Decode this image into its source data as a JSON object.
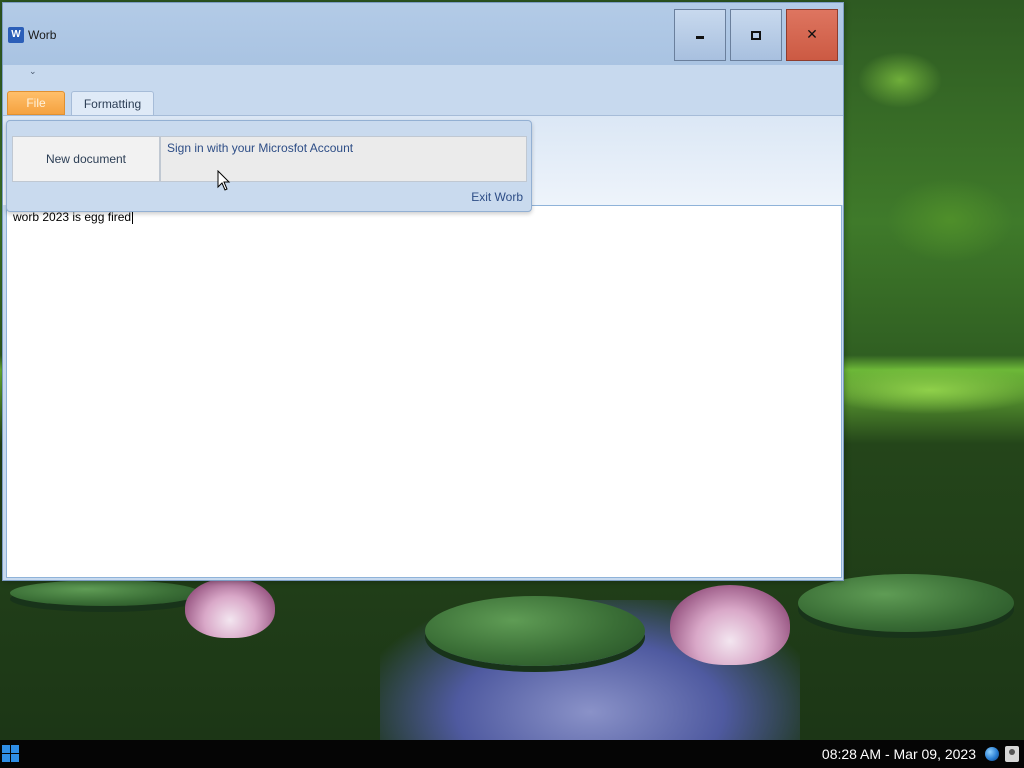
{
  "window": {
    "title": "Worb",
    "app_icon_letter": "W",
    "controls": {
      "minimize": "minimize-icon",
      "maximize": "maximize-icon",
      "close": "close-icon",
      "close_color": "#d0604a"
    }
  },
  "quick_access": {
    "glyph": "⌄"
  },
  "ribbon": {
    "tabs": [
      {
        "label": "File",
        "active": true,
        "color": "#f7a845"
      },
      {
        "label": "Formatting",
        "active": false
      }
    ]
  },
  "file_menu": {
    "new_document": "New document",
    "sign_in": "Sign in with your Microsfot Account",
    "exit": "Exit Worb"
  },
  "document": {
    "text": "worb 2023 is egg fired"
  },
  "taskbar": {
    "clock": "08:28 AM - Mar 09, 2023",
    "tray_icons": [
      "globe-icon",
      "user-icon"
    ]
  }
}
